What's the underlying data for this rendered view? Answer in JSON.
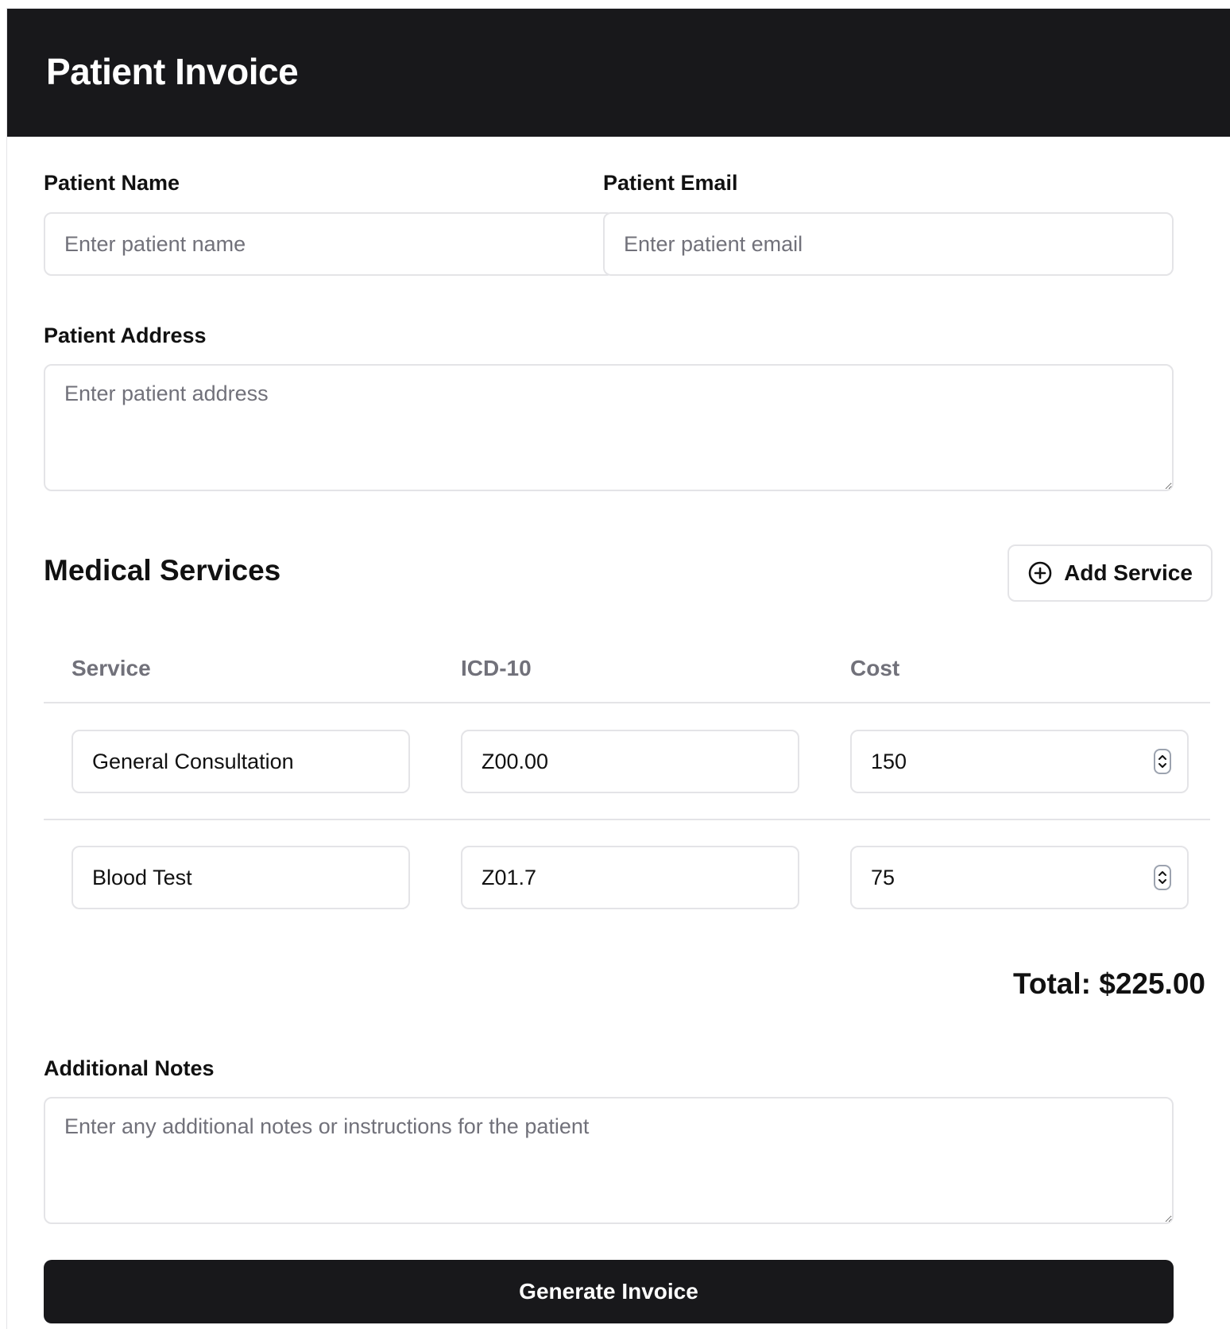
{
  "header": {
    "title": "Patient Invoice"
  },
  "form": {
    "patient_name": {
      "label": "Patient Name",
      "placeholder": "Enter patient name",
      "value": ""
    },
    "patient_email": {
      "label": "Patient Email",
      "placeholder": "Enter patient email",
      "value": ""
    },
    "patient_address": {
      "label": "Patient Address",
      "placeholder": "Enter patient address",
      "value": ""
    },
    "additional_notes": {
      "label": "Additional Notes",
      "placeholder": "Enter any additional notes or instructions for the patient",
      "value": ""
    }
  },
  "services": {
    "title": "Medical Services",
    "add_button": {
      "label": "Add Service",
      "icon": "plus-circle-icon"
    },
    "columns": [
      "Service",
      "ICD-10",
      "Cost"
    ],
    "rows": [
      {
        "service": "General Consultation",
        "icd10": "Z00.00",
        "cost": "150"
      },
      {
        "service": "Blood Test",
        "icd10": "Z01.7",
        "cost": "75"
      }
    ],
    "total_text": "Total: $225.00"
  },
  "actions": {
    "generate_label": "Generate Invoice"
  },
  "colors": {
    "header_bg": "#18181b",
    "border": "#e4e4e7",
    "placeholder": "#71717a",
    "button_bg": "#18181b"
  }
}
